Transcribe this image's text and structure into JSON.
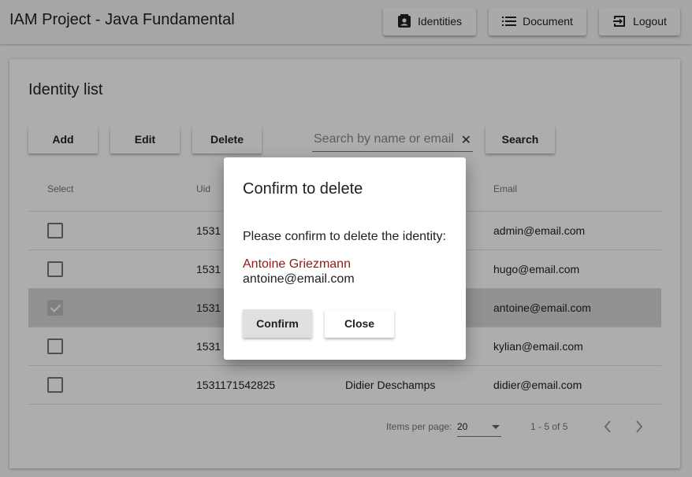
{
  "app": {
    "title": "IAM Project - Java Fundamental"
  },
  "nav": {
    "identities": "Identities",
    "document": "Document",
    "logout": "Logout"
  },
  "card": {
    "title": "Identity list",
    "actions": {
      "add": "Add",
      "edit": "Edit",
      "delete": "Delete",
      "search": "Search"
    },
    "search": {
      "placeholder": "Search by name or email",
      "value": ""
    }
  },
  "table": {
    "headers": {
      "select": "Select",
      "uid": "Uid",
      "email": "Email"
    },
    "rows": [
      {
        "uid": "1531",
        "name": "",
        "email": "admin@email.com",
        "checked": false
      },
      {
        "uid": "1531",
        "name": "",
        "email": "hugo@email.com",
        "checked": false
      },
      {
        "uid": "1531",
        "name": "",
        "email": "antoine@email.com",
        "checked": true
      },
      {
        "uid": "1531",
        "name": "",
        "email": "kylian@email.com",
        "checked": false
      },
      {
        "uid": "1531171542825",
        "name": "Didier Deschamps",
        "email": "didier@email.com",
        "checked": false
      }
    ]
  },
  "paginator": {
    "items_per_page_label": "Items per page:",
    "page_size": "20",
    "range_label": "1 - 5 of 5"
  },
  "dialog": {
    "title": "Confirm to delete",
    "message": "Please confirm to delete the identity:",
    "identity_name": "Antoine Griezmann",
    "identity_email": "antoine@email.com",
    "confirm": "Confirm",
    "close": "Close"
  },
  "colors": {
    "accent_name": "#8e1a1a",
    "selected_row": "#d7d7d7"
  }
}
